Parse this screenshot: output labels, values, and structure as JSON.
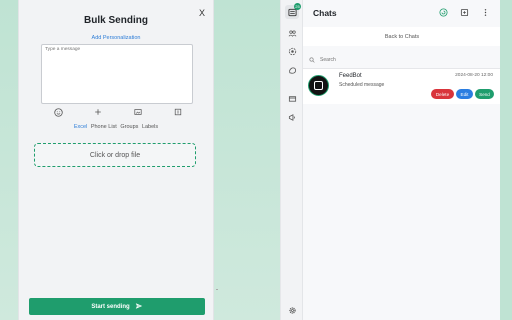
{
  "bulk": {
    "title": "Bulk Sending",
    "close_label": "X",
    "personalization_link": "Add Personalization",
    "message_placeholder": "Type a message",
    "tools": [
      "emoji-icon",
      "plus-icon",
      "image-icon",
      "template-icon"
    ],
    "tabs": [
      "Excel",
      "Phone List",
      "Groups",
      "Labels"
    ],
    "active_tab": "Excel",
    "drop_label": "Click or drop file",
    "start_label": "Start sending"
  },
  "chats": {
    "title": "Chats",
    "rail_badge": "25",
    "back_label": "Back to Chats",
    "search_placeholder": "Search",
    "items": [
      {
        "name": "FeedBot",
        "time": "2024-08-20 12:00",
        "preview": "Scheduled message",
        "actions": {
          "delete": "Delete",
          "edit": "Edit",
          "send": "Send"
        }
      }
    ]
  },
  "colors": {
    "accent": "#1f9d6d",
    "link": "#2e7dd7",
    "delete": "#d9343b",
    "edit": "#2a7de1"
  }
}
